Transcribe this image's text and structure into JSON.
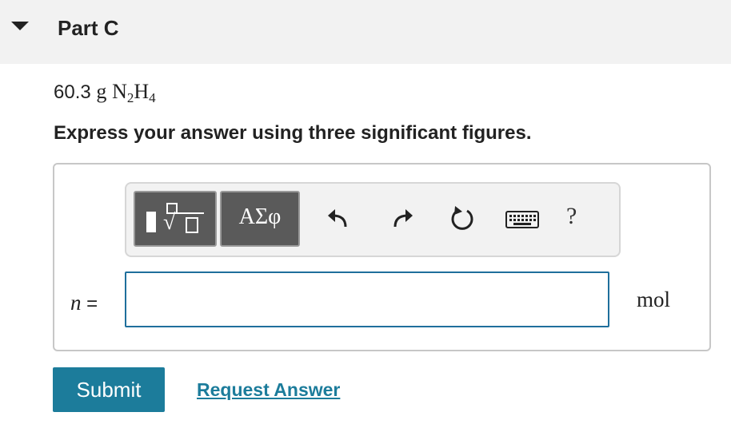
{
  "part": {
    "title": "Part C",
    "toggle_icon": "triangle-down-icon"
  },
  "problem": {
    "mass": "60.3",
    "unit": "g",
    "formula": {
      "el1": "N",
      "sub1": "2",
      "el2": "H",
      "sub2": "4"
    }
  },
  "instruction": "Express your answer using three significant figures.",
  "toolbar": {
    "symbols_label": "ΑΣφ",
    "help_label": "?",
    "icons": [
      "templates-icon",
      "undo-icon",
      "redo-icon",
      "reset-icon",
      "keyboard-icon",
      "help-icon"
    ]
  },
  "answer": {
    "variable": "n",
    "equals": "=",
    "value": "",
    "unit": "mol"
  },
  "actions": {
    "submit": "Submit",
    "request_answer": "Request Answer"
  },
  "colors": {
    "accent": "#1c7c9b",
    "input_border": "#1f6f9c",
    "header_bg": "#f2f2f2",
    "button_dark": "#5a5a5a"
  }
}
